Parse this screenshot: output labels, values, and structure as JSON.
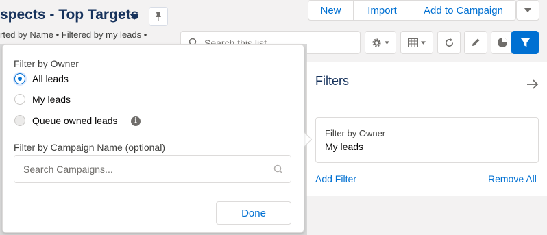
{
  "header": {
    "title": "spects - Top Targets",
    "subtitle": "rted by Name • Filtered by my leads •"
  },
  "actions": {
    "new_label": "New",
    "import_label": "Import",
    "add_to_campaign_label": "Add to Campaign"
  },
  "list_search": {
    "placeholder": "Search this list..."
  },
  "filter_popover": {
    "owner_label": "Filter by Owner",
    "options": [
      {
        "label": "All leads",
        "selected": true,
        "disabled": false
      },
      {
        "label": "My leads",
        "selected": false,
        "disabled": false
      },
      {
        "label": "Queue owned leads",
        "selected": false,
        "disabled": true
      }
    ],
    "info_icon_glyph": "i",
    "campaign_label": "Filter by Campaign Name (optional)",
    "campaign_placeholder": "Search Campaigns...",
    "done_label": "Done"
  },
  "filters_panel": {
    "title": "Filters",
    "card": {
      "label": "Filter by Owner",
      "value": "My leads"
    },
    "add_filter_label": "Add Filter",
    "remove_all_label": "Remove All"
  },
  "colors": {
    "brand_blue": "#0070d2",
    "title_navy": "#16325c",
    "filter_active_bg": "#0070d2"
  },
  "icons": [
    "pin-icon",
    "caret-down-icon",
    "search-icon",
    "gear-icon",
    "table-icon",
    "refresh-icon",
    "pencil-icon",
    "pie-chart-icon",
    "filter-icon",
    "arrow-right-icon",
    "info-icon"
  ]
}
